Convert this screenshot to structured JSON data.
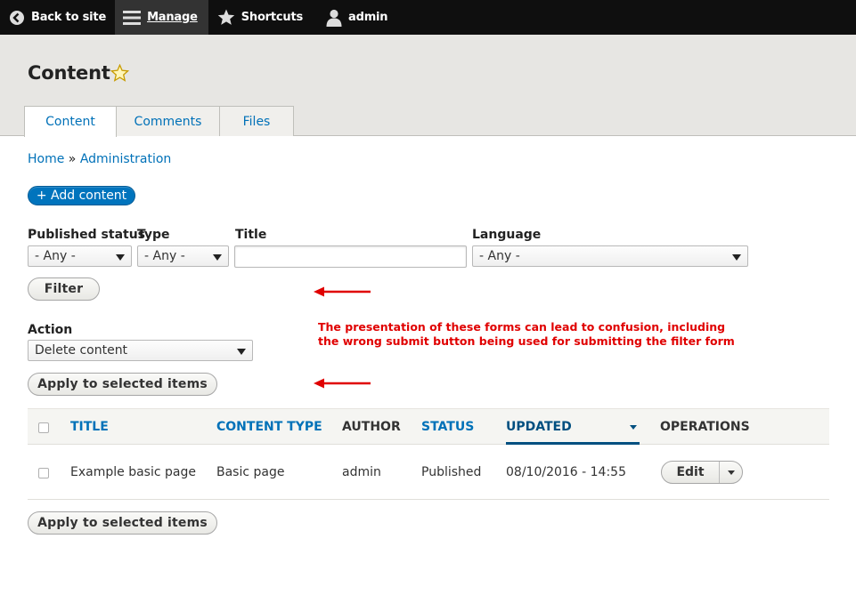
{
  "toolbar": {
    "back": "Back to site",
    "manage": "Manage",
    "shortcuts": "Shortcuts",
    "user": "admin"
  },
  "header": {
    "title": "Content",
    "tabs": [
      "Content",
      "Comments",
      "Files"
    ]
  },
  "breadcrumb": {
    "home": "Home",
    "separator": "»",
    "admin": "Administration"
  },
  "add_button": "+ Add content",
  "filters": {
    "published_status": {
      "label": "Published status",
      "value": "- Any -"
    },
    "type": {
      "label": "Type",
      "value": "- Any -"
    },
    "title": {
      "label": "Title",
      "value": ""
    },
    "language": {
      "label": "Language",
      "value": "- Any -"
    },
    "filter_button": "Filter"
  },
  "bulk": {
    "action_label": "Action",
    "action_value": "Delete content",
    "apply_button": "Apply to selected items"
  },
  "annotation": "The presentation of these forms can lead to confusion, including the wrong submit button being used for submitting the filter form",
  "annotation_color": "#e00000",
  "table": {
    "headers": [
      "TITLE",
      "CONTENT TYPE",
      "AUTHOR",
      "STATUS",
      "UPDATED",
      "OPERATIONS"
    ],
    "rows": [
      {
        "title": "Example basic page",
        "content_type": "Basic page",
        "author": "admin",
        "status": "Published",
        "updated": "08/10/2016 - 14:55",
        "operation": "Edit"
      }
    ]
  },
  "colors": {
    "link": "#0071b8",
    "primary_button": "#0074bd",
    "toolbar": "#0f0f0f",
    "header_bg": "#e7e6e3"
  }
}
